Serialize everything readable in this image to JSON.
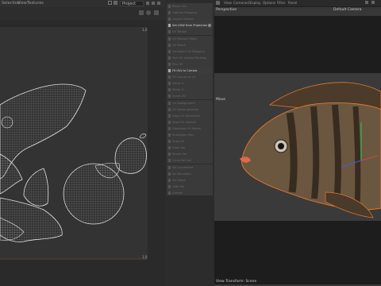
{
  "uv_editor": {
    "menu": [
      "Selection",
      "View",
      "Textures"
    ],
    "project_select": "Project",
    "corner_top_right": "1,0",
    "corner_bottom_right": "1,0"
  },
  "commands": {
    "items": [
      {
        "label": "Relax UVs",
        "bright": false
      },
      {
        "label": "Optimal Mapping",
        "bright": false
      },
      {
        "label": "Layout Options",
        "bright": false
      },
      {
        "label": "Set UVW from Projection",
        "bright": true,
        "cog": true
      },
      {
        "label": "UV Terrain",
        "bright": false
      },
      {
        "label": "UV Manual Editor",
        "bright": false
      },
      {
        "label": "UV Match",
        "bright": false
      },
      {
        "label": "Transform UV Mapping",
        "bright": false
      },
      {
        "label": "Sort UV Islands Packing",
        "bright": false
      },
      {
        "label": "Pins UV",
        "bright": false
      },
      {
        "label": "Fit UVs to Canvas",
        "bright": true
      },
      {
        "label": "Fit Canvas to UV",
        "bright": false
      },
      {
        "label": "Mirror U",
        "bright": false
      },
      {
        "label": "Mirror V",
        "bright": false
      },
      {
        "label": "Invert UV",
        "bright": false
      },
      {
        "label": "UV Realignment",
        "bright": false
      },
      {
        "label": "UV Rectangularize",
        "bright": false
      },
      {
        "label": "Align UV Horizontal",
        "bright": false
      },
      {
        "label": "Align UV Vertical",
        "bright": false
      },
      {
        "label": "Distribute UV Points",
        "bright": false
      },
      {
        "label": "Straighten Poly",
        "bright": false
      },
      {
        "label": "Snap UV",
        "bright": false
      },
      {
        "label": "Grow Sel",
        "bright": false
      },
      {
        "label": "Shrink Sel",
        "bright": false
      },
      {
        "label": "Cycle Sel Cell",
        "bright": false
      },
      {
        "label": "Sel Connected",
        "bright": false
      },
      {
        "label": "Sel Boundary",
        "bright": false
      },
      {
        "label": "Sel Seam",
        "bright": false
      },
      {
        "label": "Hide Sel",
        "bright": false
      },
      {
        "label": "Unhide",
        "bright": false
      }
    ]
  },
  "viewport": {
    "menu": [
      "View",
      "Cameras",
      "Display",
      "Options",
      "Filter",
      "Panel"
    ],
    "perspective_label": "Perspective",
    "camera_label": "Default Camera",
    "move_label": "Move",
    "footer_label": "View Transform: Scene"
  },
  "colors": {
    "uv_lines": "#d9d9d9",
    "selection_outline": "#e8782a",
    "fish_body": "#6b5640"
  }
}
